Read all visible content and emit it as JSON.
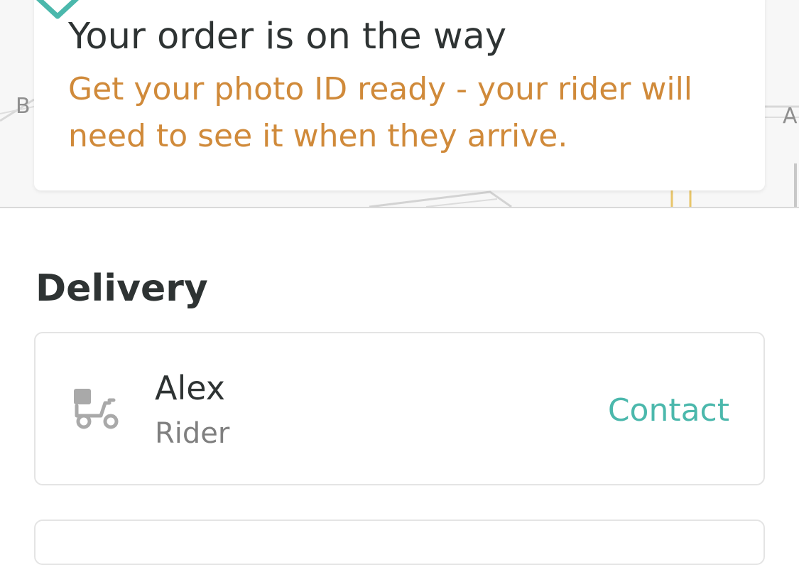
{
  "map": {
    "label_left": "B",
    "label_right": "A"
  },
  "status": {
    "title": "Your order is on the way",
    "note": "Get your photo ID ready - your rider will need to see it when they arrive.",
    "accent_color": "#4bb8ac",
    "note_color": "#d08a3a"
  },
  "delivery": {
    "section_title": "Delivery",
    "rider": {
      "icon": "scooter-icon",
      "name": "Alex",
      "role": "Rider",
      "contact_label": "Contact"
    }
  }
}
